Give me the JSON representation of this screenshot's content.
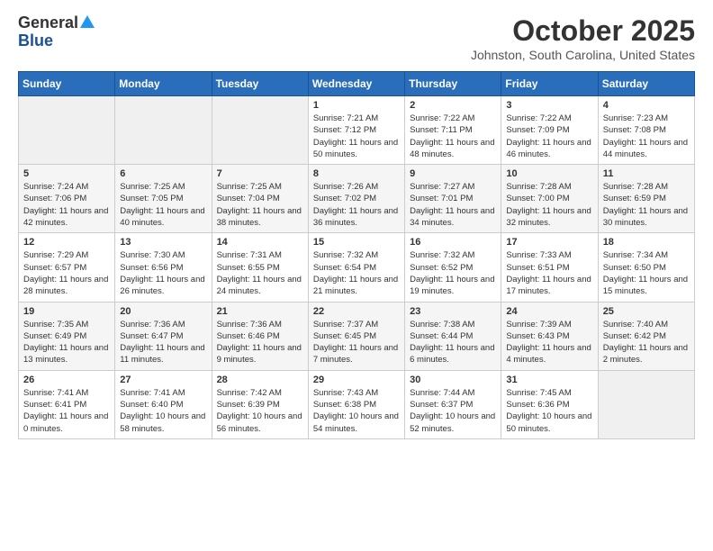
{
  "logo": {
    "general": "General",
    "blue": "Blue"
  },
  "title": "October 2025",
  "location": "Johnston, South Carolina, United States",
  "weekdays": [
    "Sunday",
    "Monday",
    "Tuesday",
    "Wednesday",
    "Thursday",
    "Friday",
    "Saturday"
  ],
  "weeks": [
    [
      {
        "day": "",
        "info": ""
      },
      {
        "day": "",
        "info": ""
      },
      {
        "day": "",
        "info": ""
      },
      {
        "day": "1",
        "info": "Sunrise: 7:21 AM\nSunset: 7:12 PM\nDaylight: 11 hours\nand 50 minutes."
      },
      {
        "day": "2",
        "info": "Sunrise: 7:22 AM\nSunset: 7:11 PM\nDaylight: 11 hours\nand 48 minutes."
      },
      {
        "day": "3",
        "info": "Sunrise: 7:22 AM\nSunset: 7:09 PM\nDaylight: 11 hours\nand 46 minutes."
      },
      {
        "day": "4",
        "info": "Sunrise: 7:23 AM\nSunset: 7:08 PM\nDaylight: 11 hours\nand 44 minutes."
      }
    ],
    [
      {
        "day": "5",
        "info": "Sunrise: 7:24 AM\nSunset: 7:06 PM\nDaylight: 11 hours\nand 42 minutes."
      },
      {
        "day": "6",
        "info": "Sunrise: 7:25 AM\nSunset: 7:05 PM\nDaylight: 11 hours\nand 40 minutes."
      },
      {
        "day": "7",
        "info": "Sunrise: 7:25 AM\nSunset: 7:04 PM\nDaylight: 11 hours\nand 38 minutes."
      },
      {
        "day": "8",
        "info": "Sunrise: 7:26 AM\nSunset: 7:02 PM\nDaylight: 11 hours\nand 36 minutes."
      },
      {
        "day": "9",
        "info": "Sunrise: 7:27 AM\nSunset: 7:01 PM\nDaylight: 11 hours\nand 34 minutes."
      },
      {
        "day": "10",
        "info": "Sunrise: 7:28 AM\nSunset: 7:00 PM\nDaylight: 11 hours\nand 32 minutes."
      },
      {
        "day": "11",
        "info": "Sunrise: 7:28 AM\nSunset: 6:59 PM\nDaylight: 11 hours\nand 30 minutes."
      }
    ],
    [
      {
        "day": "12",
        "info": "Sunrise: 7:29 AM\nSunset: 6:57 PM\nDaylight: 11 hours\nand 28 minutes."
      },
      {
        "day": "13",
        "info": "Sunrise: 7:30 AM\nSunset: 6:56 PM\nDaylight: 11 hours\nand 26 minutes."
      },
      {
        "day": "14",
        "info": "Sunrise: 7:31 AM\nSunset: 6:55 PM\nDaylight: 11 hours\nand 24 minutes."
      },
      {
        "day": "15",
        "info": "Sunrise: 7:32 AM\nSunset: 6:54 PM\nDaylight: 11 hours\nand 21 minutes."
      },
      {
        "day": "16",
        "info": "Sunrise: 7:32 AM\nSunset: 6:52 PM\nDaylight: 11 hours\nand 19 minutes."
      },
      {
        "day": "17",
        "info": "Sunrise: 7:33 AM\nSunset: 6:51 PM\nDaylight: 11 hours\nand 17 minutes."
      },
      {
        "day": "18",
        "info": "Sunrise: 7:34 AM\nSunset: 6:50 PM\nDaylight: 11 hours\nand 15 minutes."
      }
    ],
    [
      {
        "day": "19",
        "info": "Sunrise: 7:35 AM\nSunset: 6:49 PM\nDaylight: 11 hours\nand 13 minutes."
      },
      {
        "day": "20",
        "info": "Sunrise: 7:36 AM\nSunset: 6:47 PM\nDaylight: 11 hours\nand 11 minutes."
      },
      {
        "day": "21",
        "info": "Sunrise: 7:36 AM\nSunset: 6:46 PM\nDaylight: 11 hours\nand 9 minutes."
      },
      {
        "day": "22",
        "info": "Sunrise: 7:37 AM\nSunset: 6:45 PM\nDaylight: 11 hours\nand 7 minutes."
      },
      {
        "day": "23",
        "info": "Sunrise: 7:38 AM\nSunset: 6:44 PM\nDaylight: 11 hours\nand 6 minutes."
      },
      {
        "day": "24",
        "info": "Sunrise: 7:39 AM\nSunset: 6:43 PM\nDaylight: 11 hours\nand 4 minutes."
      },
      {
        "day": "25",
        "info": "Sunrise: 7:40 AM\nSunset: 6:42 PM\nDaylight: 11 hours\nand 2 minutes."
      }
    ],
    [
      {
        "day": "26",
        "info": "Sunrise: 7:41 AM\nSunset: 6:41 PM\nDaylight: 11 hours\nand 0 minutes."
      },
      {
        "day": "27",
        "info": "Sunrise: 7:41 AM\nSunset: 6:40 PM\nDaylight: 10 hours\nand 58 minutes."
      },
      {
        "day": "28",
        "info": "Sunrise: 7:42 AM\nSunset: 6:39 PM\nDaylight: 10 hours\nand 56 minutes."
      },
      {
        "day": "29",
        "info": "Sunrise: 7:43 AM\nSunset: 6:38 PM\nDaylight: 10 hours\nand 54 minutes."
      },
      {
        "day": "30",
        "info": "Sunrise: 7:44 AM\nSunset: 6:37 PM\nDaylight: 10 hours\nand 52 minutes."
      },
      {
        "day": "31",
        "info": "Sunrise: 7:45 AM\nSunset: 6:36 PM\nDaylight: 10 hours\nand 50 minutes."
      },
      {
        "day": "",
        "info": ""
      }
    ]
  ]
}
